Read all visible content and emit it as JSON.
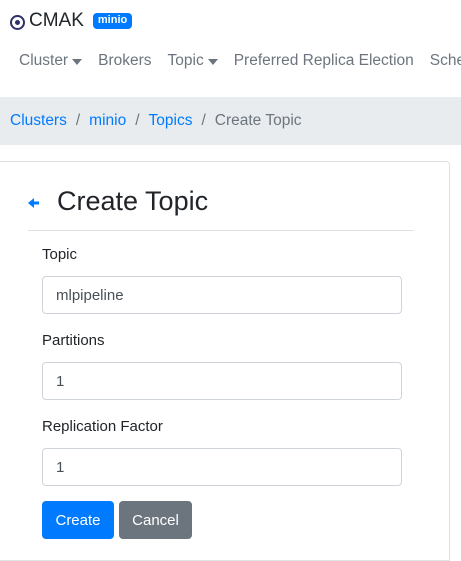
{
  "brand": {
    "name": "CMAK",
    "badge": "minio"
  },
  "nav": {
    "cluster": "Cluster",
    "brokers": "Brokers",
    "topic": "Topic",
    "preferred_replica_election": "Preferred Replica Election",
    "schedule": "Sche"
  },
  "breadcrumb": {
    "clusters": "Clusters",
    "cluster_name": "minio",
    "topics": "Topics",
    "current": "Create Topic",
    "separator": "/"
  },
  "page": {
    "title": "Create Topic"
  },
  "form": {
    "topic_label": "Topic",
    "topic_value": "mlpipeline",
    "partitions_label": "Partitions",
    "partitions_value": "1",
    "replication_label": "Replication Factor",
    "replication_value": "1"
  },
  "buttons": {
    "create": "Create",
    "cancel": "Cancel"
  },
  "colors": {
    "primary": "#007bff",
    "secondary": "#6c757d",
    "breadcrumb_bg": "#e9ecef"
  }
}
